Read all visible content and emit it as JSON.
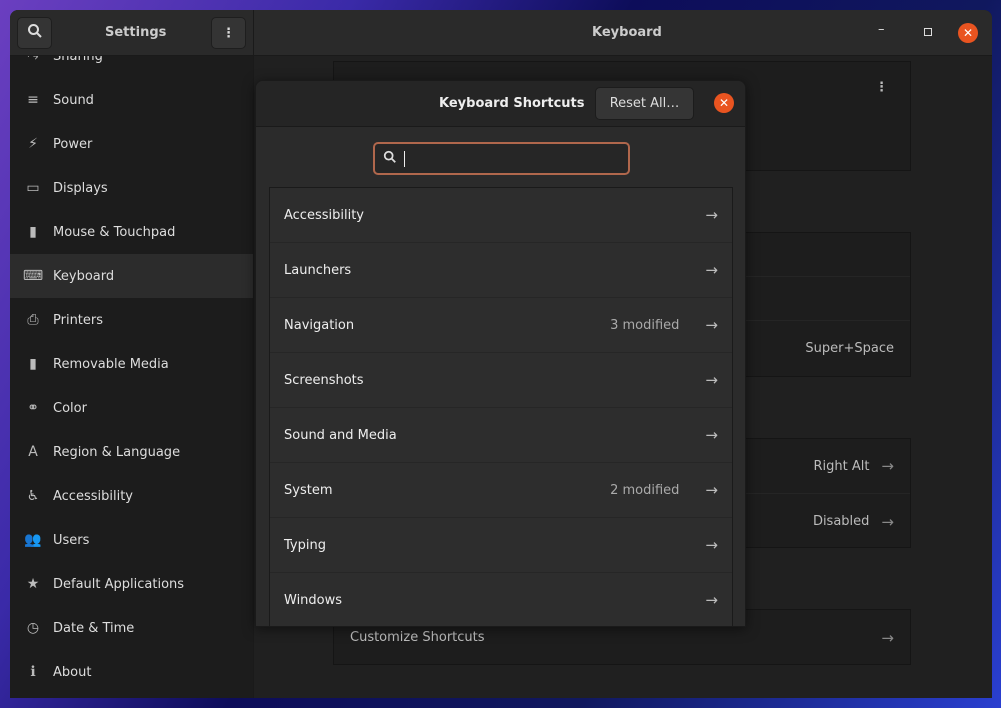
{
  "settings": {
    "title": "Settings",
    "panel_title": "Keyboard"
  },
  "sidebar": {
    "items": [
      {
        "label": "Sharing",
        "icon": "share-icon",
        "glyph": "⤳"
      },
      {
        "label": "Sound",
        "icon": "sound-icon",
        "glyph": "≡"
      },
      {
        "label": "Power",
        "icon": "power-icon",
        "glyph": "⚡"
      },
      {
        "label": "Displays",
        "icon": "display-icon",
        "glyph": "▭"
      },
      {
        "label": "Mouse & Touchpad",
        "icon": "mouse-icon",
        "glyph": "▮"
      },
      {
        "label": "Keyboard",
        "icon": "keyboard-icon",
        "glyph": "⌨"
      },
      {
        "label": "Printers",
        "icon": "printer-icon",
        "glyph": "⎙"
      },
      {
        "label": "Removable Media",
        "icon": "media-icon",
        "glyph": "▮"
      },
      {
        "label": "Color",
        "icon": "color-icon",
        "glyph": "⚭"
      },
      {
        "label": "Region & Language",
        "icon": "region-icon",
        "glyph": "A"
      },
      {
        "label": "Accessibility",
        "icon": "accessibility-icon",
        "glyph": "♿"
      },
      {
        "label": "Users",
        "icon": "users-icon",
        "glyph": "👥"
      },
      {
        "label": "Default Applications",
        "icon": "star-icon",
        "glyph": "★"
      },
      {
        "label": "Date & Time",
        "icon": "clock-icon",
        "glyph": "◷"
      },
      {
        "label": "About",
        "icon": "info-icon",
        "glyph": "ℹ"
      }
    ],
    "selected": "Keyboard"
  },
  "background": {
    "value1": "Super+Space",
    "rows": [
      {
        "value": "Right Alt"
      },
      {
        "value": "Disabled"
      }
    ],
    "customize": "Customize Shortcuts"
  },
  "dialog": {
    "title": "Keyboard Shortcuts",
    "reset": "Reset All…",
    "search_value": "",
    "categories": [
      {
        "label": "Accessibility",
        "modified": ""
      },
      {
        "label": "Launchers",
        "modified": ""
      },
      {
        "label": "Navigation",
        "modified": "3 modified"
      },
      {
        "label": "Screenshots",
        "modified": ""
      },
      {
        "label": "Sound and Media",
        "modified": ""
      },
      {
        "label": "System",
        "modified": "2 modified"
      },
      {
        "label": "Typing",
        "modified": ""
      },
      {
        "label": "Windows",
        "modified": ""
      }
    ]
  },
  "colors": {
    "accent": "#e95420",
    "focus": "#b0674c"
  }
}
